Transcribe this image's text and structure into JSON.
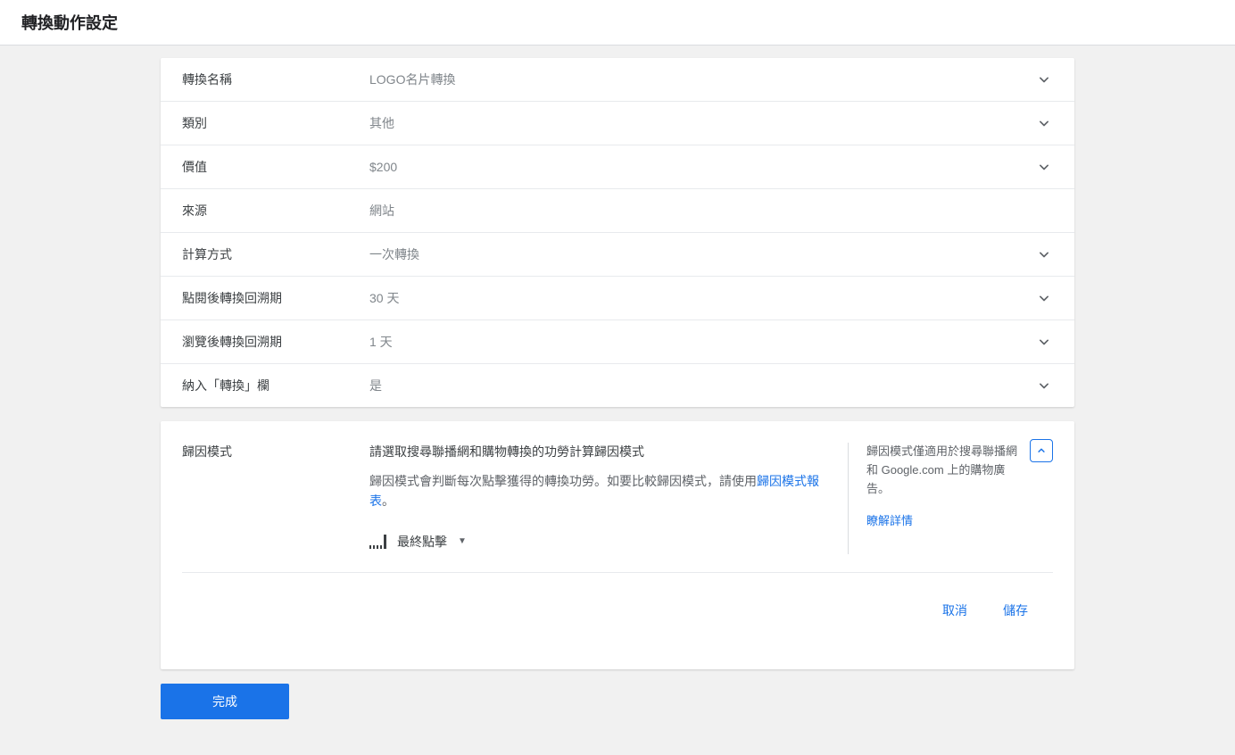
{
  "header": {
    "title": "轉換動作設定"
  },
  "settings": {
    "rows": [
      {
        "label": "轉換名稱",
        "value": "LOGO名片轉換",
        "chevron": true
      },
      {
        "label": "類別",
        "value": "其他",
        "chevron": true
      },
      {
        "label": "價值",
        "value": "$200",
        "chevron": true
      },
      {
        "label": "來源",
        "value": "網站",
        "chevron": false
      },
      {
        "label": "計算方式",
        "value": "一次轉換",
        "chevron": true
      },
      {
        "label": "點閱後轉換回溯期",
        "value": "30 天",
        "chevron": true
      },
      {
        "label": "瀏覽後轉換回溯期",
        "value": "1 天",
        "chevron": true
      },
      {
        "label": "納入「轉換」欄",
        "value": "是",
        "chevron": true
      }
    ]
  },
  "attribution": {
    "label": "歸因模式",
    "title": "請選取搜尋聯播網和購物轉換的功勞計算歸因模式",
    "desc_part1": "歸因模式會判斷每次點擊獲得的轉換功勞。如要比較歸因模式，請使用",
    "link_text": "歸因模式報表",
    "desc_part2": "。",
    "selected": "最終點擊",
    "side_note": "歸因模式僅適用於搜尋聯播網和 Google.com 上的購物廣告。",
    "learn_more": "瞭解詳情",
    "cancel": "取消",
    "save": "儲存"
  },
  "footer": {
    "done": "完成"
  }
}
